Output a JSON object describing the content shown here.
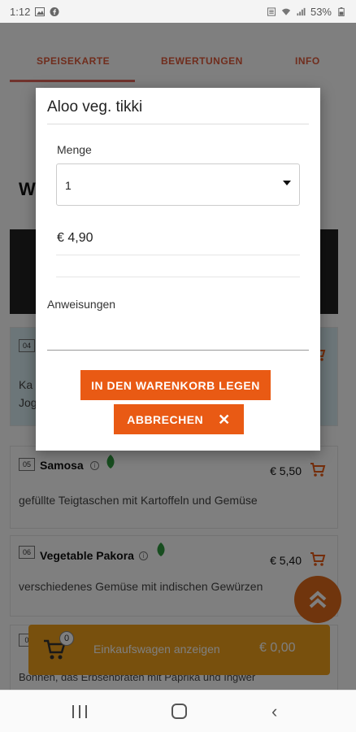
{
  "status": {
    "time": "1:12",
    "battery": "53%"
  },
  "tabs": [
    "SPEISEKARTE",
    "BEWERTUNGEN",
    "INFO"
  ],
  "background": {
    "section_title_partial": "W",
    "items": [
      {
        "code": "04",
        "desc_partial_1": "Ka",
        "desc_partial_2": "Jog"
      },
      {
        "code": "05",
        "name": "Samosa",
        "price": "€ 5,50",
        "desc": "gefüllte Teigtaschen mit Kartoffeln und Gemüse"
      },
      {
        "code": "06",
        "name": "Vegetable Pakora",
        "price": "€ 5,40",
        "desc": "verschiedenes Gemüse mit indischen Gewürzen"
      },
      {
        "code": "0"
      }
    ],
    "bottom_text": "Bohnen, das Erbsenbraten mit Paprika und Ingwer"
  },
  "cart": {
    "count": "0",
    "label": "Einkaufswagen anzeigen",
    "total": "€ 0,00"
  },
  "dialog": {
    "title": "Aloo veg. tikki",
    "qty_label": "Menge",
    "qty_value": "1",
    "price": "€ 4,90",
    "instructions_label": "Anweisungen",
    "instructions_value": "",
    "add_button": "IN DEN WARENKORB LEGEN",
    "cancel_button": "ABBRECHEN"
  },
  "colors": {
    "accent": "#e95a14",
    "cart_bar": "#f0a01a",
    "tab": "#e05a3a"
  }
}
